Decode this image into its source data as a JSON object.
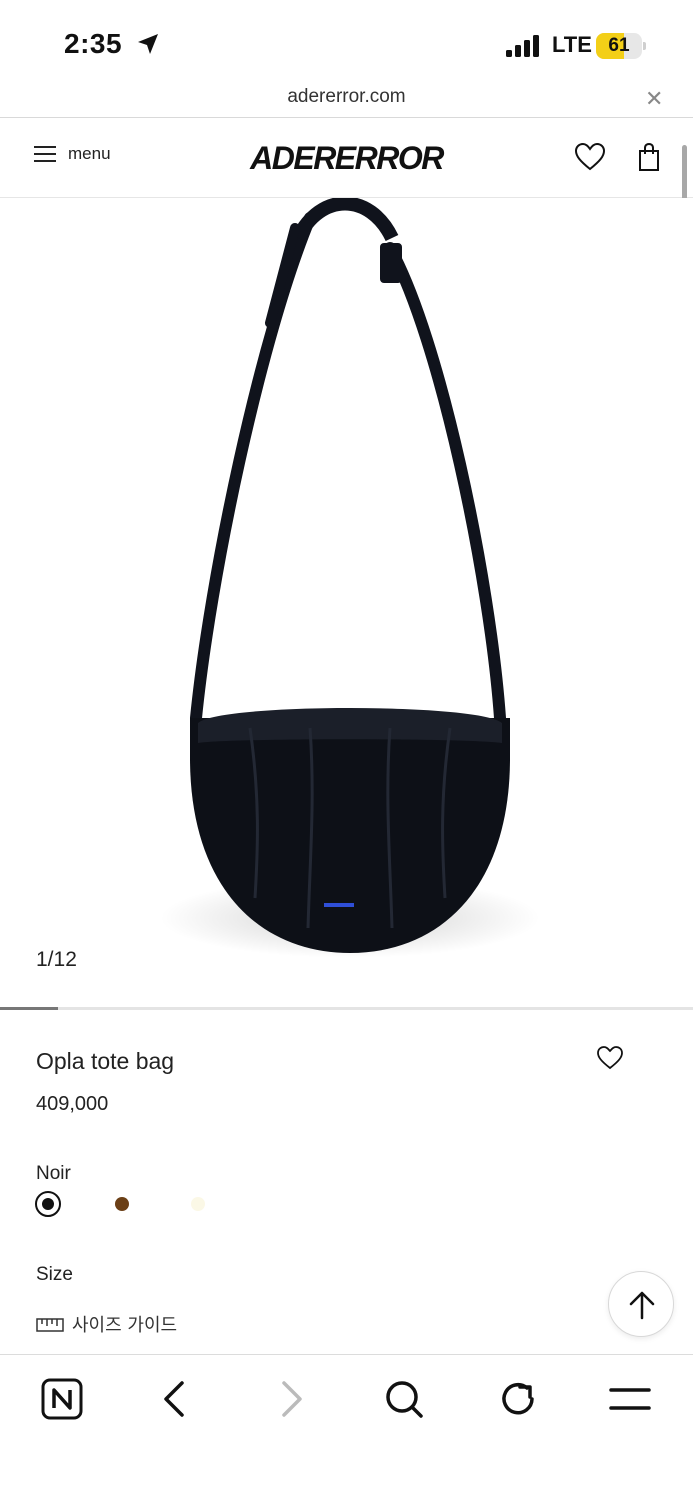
{
  "status_bar": {
    "time": "2:35",
    "network": "LTE",
    "battery_level": "61",
    "battery_fraction": 0.61
  },
  "browser": {
    "url": "adererror.com",
    "close_glyph": "✕"
  },
  "header": {
    "menu_label": "menu",
    "brand": "ADERERROR",
    "icons": [
      "hamburger-icon",
      "heart-icon",
      "shopping-bag-icon"
    ]
  },
  "gallery": {
    "counter": "1/12",
    "progress_fraction": 0.083
  },
  "product": {
    "title": "Opla tote bag",
    "price": "409,000",
    "selected_color": "Noir",
    "colors": [
      {
        "name": "Noir",
        "hex": "#111111",
        "selected": true
      },
      {
        "name": "Brown",
        "hex": "#6b3f16",
        "selected": false
      },
      {
        "name": "Ivory",
        "hex": "#fbf8e6",
        "selected": false
      }
    ],
    "size_label": "Size",
    "size_guide_label": "사이즈 가이드"
  },
  "toolbar": {
    "items": [
      "naver-n-icon",
      "back-icon",
      "forward-icon",
      "search-icon",
      "refresh-icon",
      "menu-icon"
    ]
  },
  "colors": {
    "battery": "#f3cf17",
    "text": "#111111",
    "divider": "#d9d9d9"
  }
}
